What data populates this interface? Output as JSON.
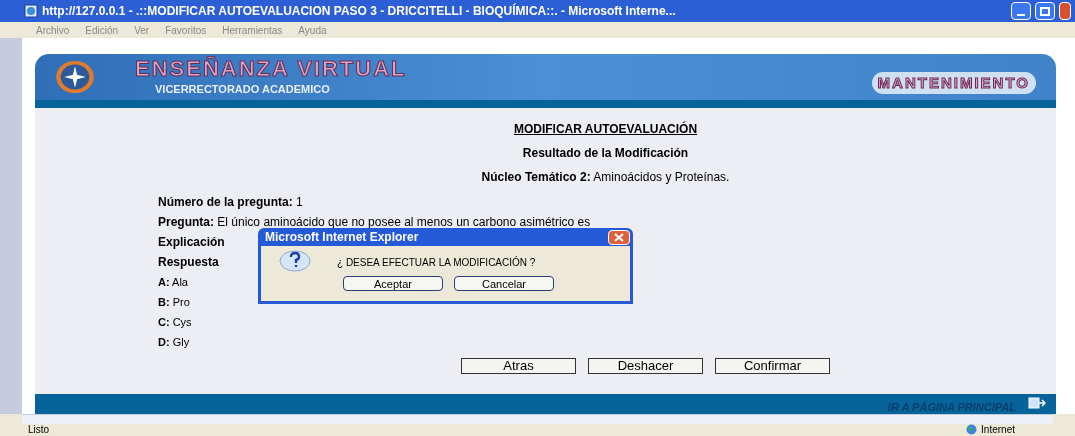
{
  "window": {
    "title": "http://127.0.0.1 - .::MODIFICAR AUTOEVALUACION PASO 3 - DRICCITELLI - BIOQUÍMICA::. - Microsoft Interne..."
  },
  "menu": [
    "Archivo",
    "Edición",
    "Ver",
    "Favoritos",
    "Herramientas",
    "Ayuda"
  ],
  "banner": {
    "title": "ENSEÑANZA VIRTUAL",
    "subtitle": "VICERRECTORADO ACADEMICO",
    "badge": "MANTENIMIENTO"
  },
  "page": {
    "heading": "MODIFICAR AUTOEVALUACIÓN",
    "subheading": "Resultado de la Modificación",
    "topic": {
      "label": "Núcleo Temático 2:",
      "value": "Aminoácidos y Proteínas."
    },
    "fields": [
      {
        "label": "Número de la pregunta:",
        "value": "1"
      },
      {
        "label": "Pregunta:",
        "value": "El único aminoácido que no posee al menos un carbono asimétrico es"
      },
      {
        "label": "Explicación"
      },
      {
        "label": "Respuesta"
      }
    ],
    "answers": [
      {
        "label": "A:",
        "value": "Ala"
      },
      {
        "label": "B:",
        "value": "Pro"
      },
      {
        "label": "C:",
        "value": "Cys"
      },
      {
        "label": "D:",
        "value": "Gly"
      }
    ],
    "buttons": [
      "Atras",
      "Deshacer",
      "Confirmar"
    ]
  },
  "footer": {
    "link": "IR A PÁGINA PRINCIPAL"
  },
  "dialog": {
    "title": "Microsoft Internet Explorer",
    "message": "¿ DESEA EFECTUAR LA MODIFICACIÓN ?",
    "buttons": [
      "Aceptar",
      "Cancelar"
    ]
  },
  "status_bar": {
    "text": "Listo",
    "zone": "Internet"
  }
}
